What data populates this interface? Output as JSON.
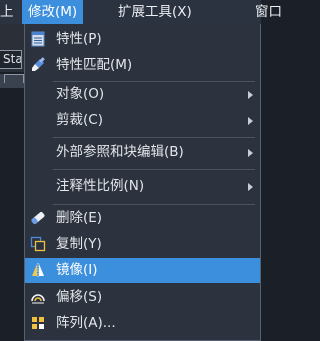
{
  "menubar": {
    "left_fragment": "上",
    "active_menu": "修改(M)",
    "ext_tools": "扩展工具(X)",
    "window_menu": "窗口"
  },
  "background": {
    "input_fragment": "Sta"
  },
  "dropdown": {
    "items": [
      {
        "label": "特性(P)",
        "icon": "properties-icon"
      },
      {
        "label": "特性匹配(M)",
        "icon": "match-properties-brush-icon"
      },
      {
        "label": "对象(O)",
        "submenu": true
      },
      {
        "label": "剪裁(C)",
        "submenu": true
      },
      {
        "label": "外部参照和块编辑(B)",
        "submenu": true
      },
      {
        "label": "注释性比例(N)",
        "submenu": true
      },
      {
        "label": "删除(E)",
        "icon": "eraser-icon"
      },
      {
        "label": "复制(Y)",
        "icon": "copy-icon"
      },
      {
        "label": "镜像(I)",
        "icon": "mirror-icon",
        "highlighted": true
      },
      {
        "label": "偏移(S)",
        "icon": "offset-icon"
      },
      {
        "label": "阵列(A)...",
        "icon": "array-icon"
      }
    ]
  },
  "colors": {
    "highlight": "#3c8fdd",
    "menu_bg": "#2c333e",
    "menubar_bg": "#2b3240"
  }
}
